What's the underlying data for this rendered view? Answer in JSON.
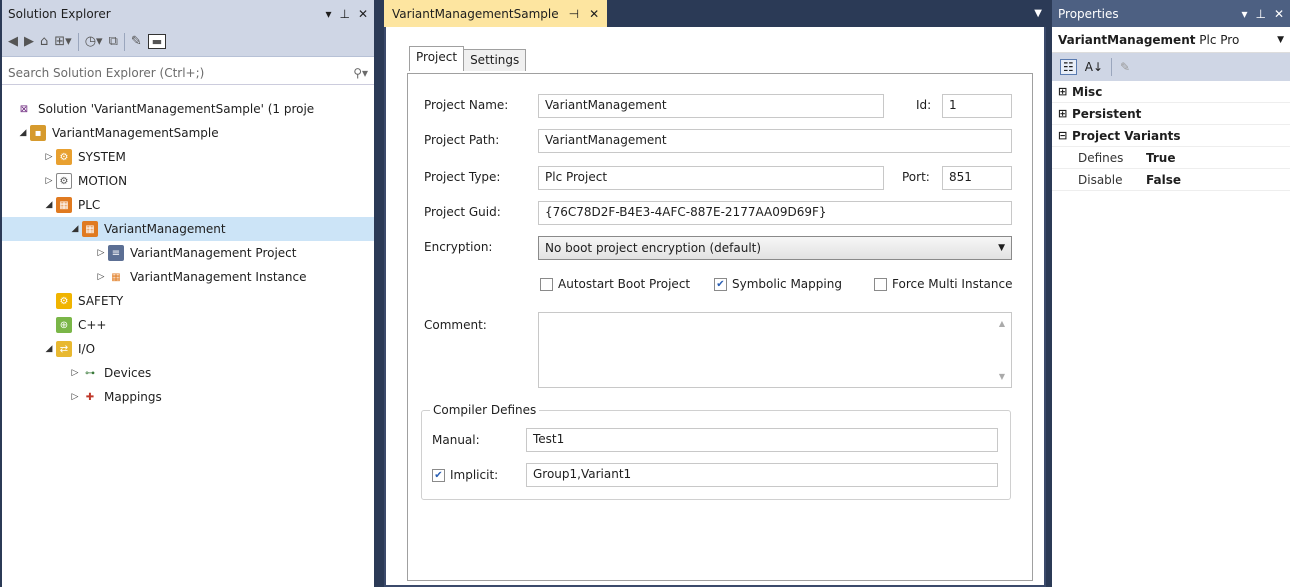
{
  "solution_explorer": {
    "title": "Solution Explorer",
    "controls": [
      "▾",
      "⊥",
      "✕"
    ],
    "search_placeholder": "Search Solution Explorer (Ctrl+;)",
    "tree": [
      {
        "label": "Solution 'VariantManagementSample' (1 proje",
        "depth": 0,
        "arrow": "",
        "icon": "solution-icon"
      },
      {
        "label": "VariantManagementSample",
        "depth": 1,
        "arrow": "◢",
        "icon": "project-icon"
      },
      {
        "label": "SYSTEM",
        "depth": 2,
        "arrow": "▷",
        "icon": "system-icon"
      },
      {
        "label": "MOTION",
        "depth": 2,
        "arrow": "▷",
        "icon": "motion-icon"
      },
      {
        "label": "PLC",
        "depth": 2,
        "arrow": "◢",
        "icon": "plc-icon"
      },
      {
        "label": "VariantManagement",
        "depth": 3,
        "arrow": "◢",
        "icon": "plc-project-icon",
        "selected": true
      },
      {
        "label": "VariantManagement Project",
        "depth": 4,
        "arrow": "▷",
        "icon": "project-file-icon"
      },
      {
        "label": "VariantManagement Instance",
        "depth": 4,
        "arrow": "▷",
        "icon": "instance-icon"
      },
      {
        "label": "SAFETY",
        "depth": 2,
        "arrow": "",
        "icon": "safety-icon"
      },
      {
        "label": "C++",
        "depth": 2,
        "arrow": "",
        "icon": "cpp-icon"
      },
      {
        "label": "I/O",
        "depth": 2,
        "arrow": "◢",
        "icon": "io-icon"
      },
      {
        "label": "Devices",
        "depth": 3,
        "arrow": "▷",
        "icon": "devices-icon"
      },
      {
        "label": "Mappings",
        "depth": 3,
        "arrow": "▷",
        "icon": "mappings-icon"
      }
    ]
  },
  "editor": {
    "tab_title": "VariantManagementSample",
    "tab_pin": "⊣",
    "tab_close": "✕",
    "tabs": [
      "Project",
      "Settings"
    ],
    "labels": {
      "project_name": "Project Name:",
      "id": "Id:",
      "project_path": "Project Path:",
      "project_type": "Project Type:",
      "port": "Port:",
      "project_guid": "Project Guid:",
      "encryption": "Encryption:",
      "comment": "Comment:",
      "compiler_defines": "Compiler Defines",
      "manual": "Manual:",
      "implicit": "Implicit:"
    },
    "values": {
      "project_name": "VariantManagement",
      "id": "1",
      "project_path": "VariantManagement",
      "project_type": "Plc Project",
      "port": "851",
      "project_guid": "{76C78D2F-B4E3-4AFC-887E-2177AA09D69F}",
      "encryption": "No boot project encryption (default)",
      "manual": "Test1",
      "implicit": "Group1,Variant1"
    },
    "checkboxes": {
      "autostart": {
        "label": "Autostart Boot Project",
        "checked": false
      },
      "symbolic": {
        "label": "Symbolic Mapping",
        "checked": true
      },
      "force_multi": {
        "label": "Force Multi Instance",
        "checked": false
      },
      "implicit": {
        "checked": true
      }
    }
  },
  "properties": {
    "title": "Properties",
    "object_name": "VariantManagement",
    "object_type": "Plc Pro",
    "categories": [
      {
        "name": "Misc",
        "expanded": false
      },
      {
        "name": "Persistent",
        "expanded": false
      },
      {
        "name": "Project Variants",
        "expanded": true
      }
    ],
    "rows": [
      {
        "name": "Defines",
        "value": "True"
      },
      {
        "name": "Disable",
        "value": "False"
      }
    ]
  },
  "colors": {
    "background": "#2b3a56",
    "active_tab": "#fde5a0",
    "selection": "#cce4f7",
    "toolbar": "#cfd6e5"
  }
}
